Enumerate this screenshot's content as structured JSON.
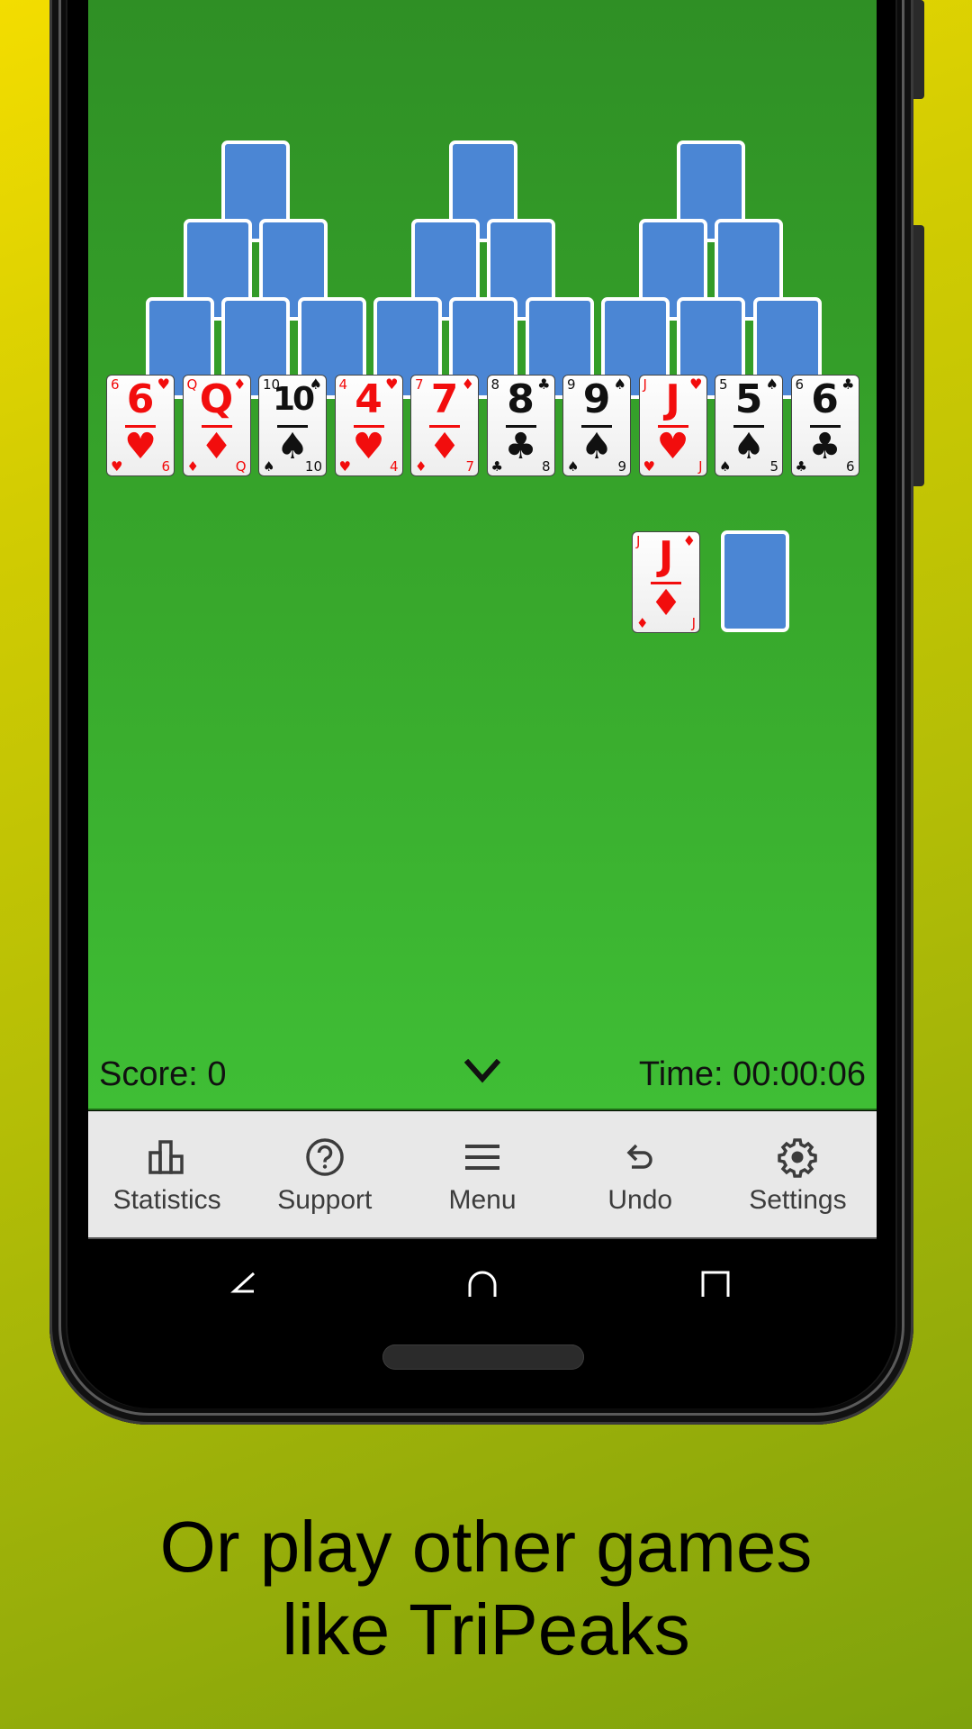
{
  "game": {
    "name": "TriPeaks",
    "face_down_rows": [
      {
        "count_per_peak": 1,
        "row": 1
      },
      {
        "count_per_peak": 2,
        "row": 2
      },
      {
        "count_per_peak": 3,
        "row": 3
      }
    ],
    "face_up_row": [
      {
        "rank": "6",
        "suit": "hearts",
        "symbol": "♥",
        "color": "red"
      },
      {
        "rank": "Q",
        "suit": "diamonds",
        "symbol": "♦",
        "color": "red"
      },
      {
        "rank": "10",
        "suit": "spades",
        "symbol": "♠",
        "color": "black"
      },
      {
        "rank": "4",
        "suit": "hearts",
        "symbol": "♥",
        "color": "red"
      },
      {
        "rank": "7",
        "suit": "diamonds",
        "symbol": "♦",
        "color": "red"
      },
      {
        "rank": "8",
        "suit": "clubs",
        "symbol": "♣",
        "color": "black"
      },
      {
        "rank": "9",
        "suit": "spades",
        "symbol": "♠",
        "color": "black"
      },
      {
        "rank": "J",
        "suit": "hearts",
        "symbol": "♥",
        "color": "red"
      },
      {
        "rank": "5",
        "suit": "spades",
        "symbol": "♠",
        "color": "black"
      },
      {
        "rank": "6",
        "suit": "clubs",
        "symbol": "♣",
        "color": "black"
      }
    ],
    "waste": {
      "rank": "J",
      "suit": "diamonds",
      "symbol": "♦",
      "color": "red"
    },
    "stock": {
      "face": "down"
    }
  },
  "status": {
    "score": "Score: 0",
    "time": "Time: 00:00:06"
  },
  "toolbar": [
    {
      "label": "Statistics",
      "icon": "bar-chart-icon"
    },
    {
      "label": "Support",
      "icon": "help-circle-icon"
    },
    {
      "label": "Menu",
      "icon": "hamburger-menu-icon"
    },
    {
      "label": "Undo",
      "icon": "undo-icon"
    },
    {
      "label": "Settings",
      "icon": "gear-icon"
    }
  ],
  "caption": {
    "line1": "Or play other games",
    "line2": "like TriPeaks"
  },
  "colors": {
    "table_green": "#37a62b",
    "card_back": "#4b86d4",
    "red_suit": "#f20d0d",
    "toolbar_bg": "#e8e8e8"
  }
}
